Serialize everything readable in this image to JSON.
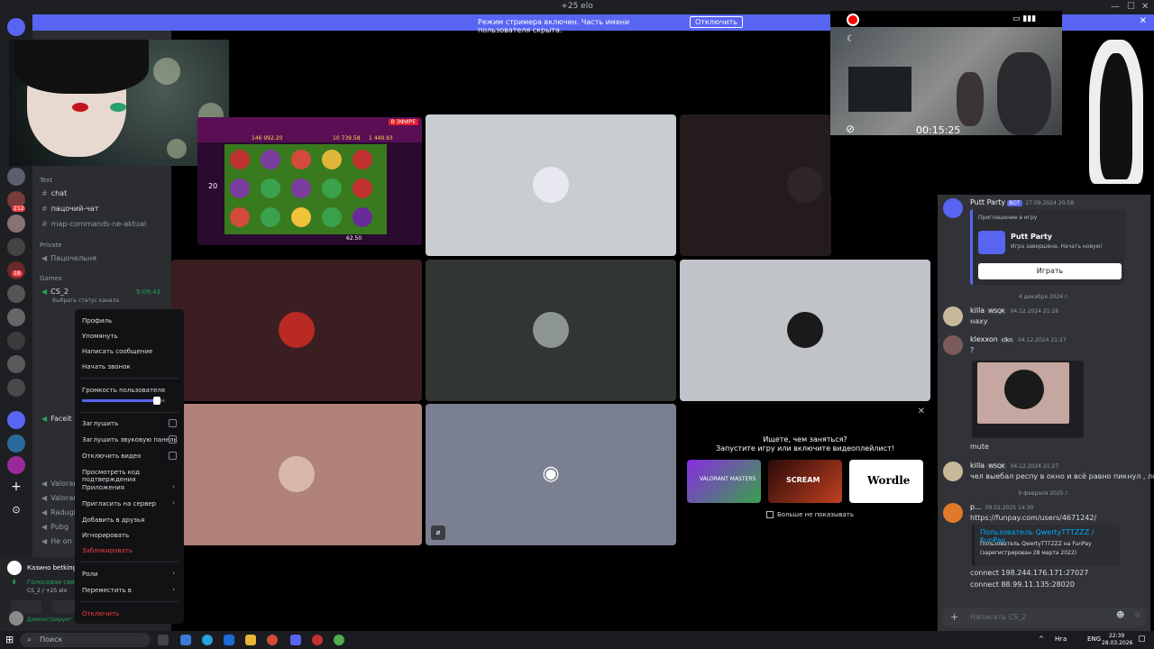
{
  "window": {
    "title": "+25 elo",
    "minimize": "—",
    "maximize": "☐",
    "close": "✕"
  },
  "banner": {
    "message": "Режим стримера включен. Часть имени пользователя скрыта.",
    "button": "Отключить",
    "close": "✕"
  },
  "sidebar": {
    "categories": {
      "text": "Text",
      "private": "Private",
      "games": "Games"
    },
    "text_channels": [
      "chat",
      "пацочий-чат",
      "map-commands-ne-aktual"
    ],
    "private_channels": [
      "Пацочельня"
    ],
    "voice_channel": {
      "name": "CS_2",
      "timer": "5:09:43",
      "status": "Выбрать статус канала"
    },
    "other_channels": [
      "Faceit",
      "Valorant",
      "Valorant",
      "Radugi",
      "Pubg",
      "Не оп"
    ],
    "server_badges": [
      "212",
      "18"
    ],
    "activity_name": "Казино betking",
    "voice_status": "Голосовая связь",
    "voice_sub": "CS_2 / +25 elo",
    "user_status": "Демонстрирует"
  },
  "context_menu": {
    "items": [
      "Профиль",
      "Упомянуть",
      "Написать сообщение",
      "Начать звонок"
    ],
    "volume_label": "Громкость пользователя",
    "volume_level": 0.9,
    "toggles": [
      "Заглушить",
      "Заглушить звуковую панель",
      "Отключить видео"
    ],
    "actions": [
      "Просмотреть код подтверждения",
      "Приложения",
      "Пригласить на сервер",
      "Добавить в друзья",
      "Игнорировать"
    ],
    "block": "Заблокировать",
    "roles": "Роли",
    "move": "Переместить в",
    "disconnect": "Отключить"
  },
  "slot_stream": {
    "live": "В ЭФИРЕ",
    "balances": [
      "146 992.20",
      "10 739.58",
      "1 449.93"
    ],
    "bet": "62.50",
    "multiplier": "20"
  },
  "activity": {
    "title_line1": "Ищете, чем заняться?",
    "title_line2": "Запустите игру или включите видеоплейлист!",
    "cards": [
      "VALORANT MASTERS",
      "SCREAM",
      "Wordle"
    ],
    "dont_show": "Больше не показывать",
    "close": "✕"
  },
  "overlay": {
    "timer": "00:15:25"
  },
  "chat": {
    "bot_name": "Putt Party",
    "bot_tag": "BOT",
    "bot_ts": "27.09.2024 20:58",
    "invite_title": "Приглашение в игру",
    "game_title": "Putt Party",
    "game_sub": "Игра завершена. Начать новую!",
    "play_button": "Играть",
    "date1": "4 декабря 2024 г.",
    "messages": [
      {
        "user": "killa",
        "tag": "WSQK",
        "ts": "04.12.2024 21:26",
        "text": "наху"
      },
      {
        "user": "klexxon",
        "tag": "clkn",
        "ts": "04.12.2024 21:27",
        "text": "?"
      },
      {
        "user": "",
        "tag": "",
        "ts": "",
        "text": "mute"
      },
      {
        "user": "killa",
        "tag": "WSQK",
        "ts": "04.12.2024 21:27",
        "text": "чел выебал респу в окно и всё равно пикнул , лол"
      }
    ],
    "date2": "9 февраля 2025 г.",
    "link_user": "p...",
    "link_ts": "09.02.2025 14:30",
    "link": "https://funpay.com/users/4671242/",
    "embed_title": "Пользователь QwertyTTTZZZ / FunPay",
    "embed_desc1": "Пользователь QwertyTTTZZZ на FunPay",
    "embed_desc2": "(зарегистрирован 28 марта 2022)",
    "connect1": "connect 198.244.176.171:27027",
    "connect2": "connect 88.99.11.135:28020",
    "input_placeholder": "Написать CS_2"
  },
  "taskbar": {
    "search_placeholder": "Поиск",
    "weather": "Нга",
    "lang": "ENG",
    "time": "22:39",
    "date": "28.03.2026"
  },
  "colors": {
    "blurple": "#5865f2",
    "danger": "#f23f43",
    "online": "#23a55a"
  }
}
